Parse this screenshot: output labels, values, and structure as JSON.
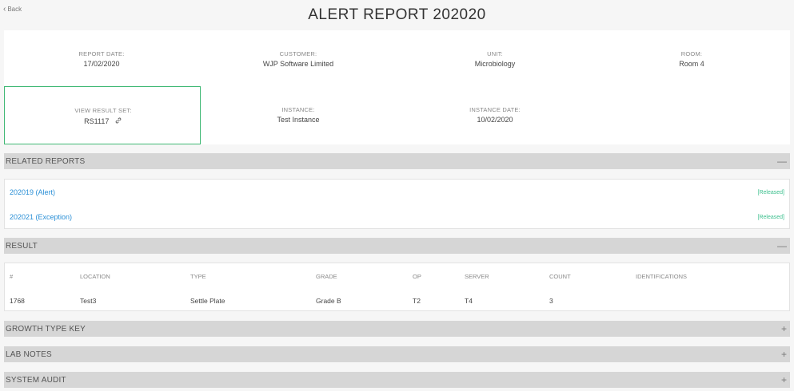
{
  "nav": {
    "back_label": "Back"
  },
  "page": {
    "title": "ALERT REPORT 202020"
  },
  "info": {
    "report_date": {
      "label": "REPORT DATE:",
      "value": "17/02/2020"
    },
    "customer": {
      "label": "CUSTOMER:",
      "value": "WJP Software Limited"
    },
    "unit": {
      "label": "UNIT:",
      "value": "Microbiology"
    },
    "room": {
      "label": "ROOM:",
      "value": "Room 4"
    },
    "result_set": {
      "label": "VIEW RESULT SET:",
      "value": "RS1117"
    },
    "instance": {
      "label": "INSTANCE:",
      "value": "Test Instance"
    },
    "instance_date": {
      "label": "INSTANCE DATE:",
      "value": "10/02/2020"
    }
  },
  "sections": {
    "related": {
      "title": "RELATED REPORTS",
      "toggle": "—"
    },
    "result": {
      "title": "RESULT",
      "toggle": "—"
    },
    "growth": {
      "title": "GROWTH TYPE KEY",
      "toggle": "+"
    },
    "lab": {
      "title": "LAB NOTES",
      "toggle": "+"
    },
    "audit": {
      "title": "SYSTEM AUDIT",
      "toggle": "+"
    }
  },
  "related_reports": [
    {
      "label": "202019 (Alert)",
      "status": "[Released]"
    },
    {
      "label": "202021 (Exception)",
      "status": "[Released]"
    }
  ],
  "result_table": {
    "headers": [
      "#",
      "LOCATION",
      "TYPE",
      "GRADE",
      "OP",
      "SERVER",
      "COUNT",
      "IDENTIFICATIONS"
    ],
    "rows": [
      [
        "1768",
        "Test3",
        "Settle Plate",
        "Grade B",
        "T2",
        "T4",
        "3",
        ""
      ]
    ]
  },
  "colors": {
    "accent_green": "#3fb874",
    "link_blue": "#2a8fd6",
    "status_green": "#3bbf8d",
    "bar_grey": "#d6d6d6"
  }
}
